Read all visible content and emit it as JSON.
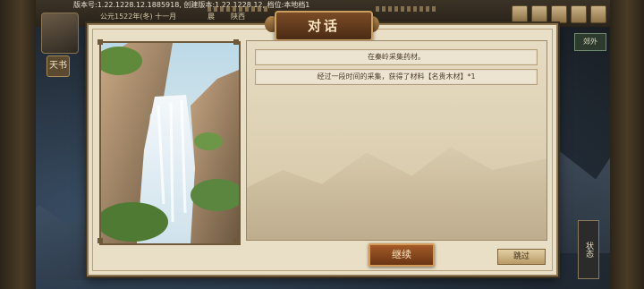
{
  "status_bar": {
    "version_info": "版本号:1.22.1228.12.1885918, 创建版本:1.22.1228.12, 档位:本地档1",
    "date": "公元1522年(冬) 十一月",
    "season": "晨",
    "place": "陕西"
  },
  "outskirts_tab": "郊外",
  "side_tab": "天书",
  "vertical_tab": "状态",
  "dialog": {
    "title": "对话",
    "messages": [
      "在秦岭采集药材。",
      "经过一段时间的采集，获得了材料【名贵木材】*1"
    ],
    "continue_label": "继续",
    "skip_label": "跳过"
  },
  "icons": {
    "avatar": "character-portrait",
    "scene": "waterfall-landscape"
  },
  "colors": {
    "dialog_bg": "#e9dfc6",
    "title_plaque": "#7a4b26",
    "continue_button": "#a35a27"
  }
}
